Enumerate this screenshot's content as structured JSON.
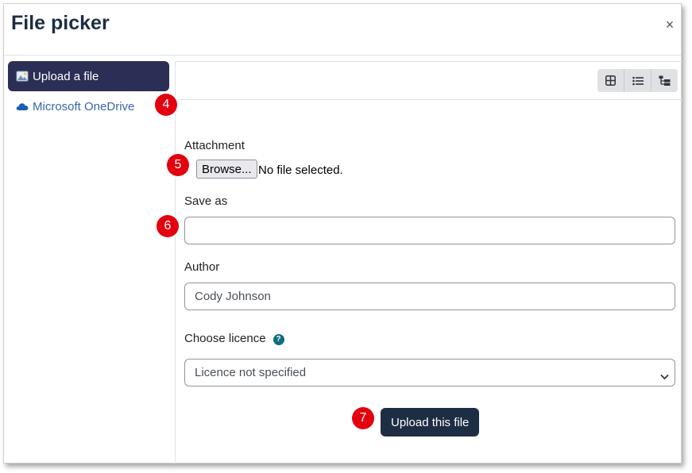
{
  "dialog": {
    "title": "File picker",
    "close_glyph": "×"
  },
  "sidebar": {
    "items": [
      {
        "label": "Upload a file",
        "icon": "upload-icon",
        "active": true
      },
      {
        "label": "Microsoft OneDrive",
        "icon": "onedrive-cloud-icon",
        "active": false
      }
    ]
  },
  "toolbar": {
    "views": [
      "icons-view-icon",
      "list-view-icon",
      "tree-view-icon"
    ]
  },
  "form": {
    "attachment_label": "Attachment",
    "browse_label": "Browse...",
    "no_file_text": "No file selected.",
    "save_as_label": "Save as",
    "save_as_value": "",
    "author_label": "Author",
    "author_value": "Cody Johnson",
    "licence_label": "Choose licence",
    "licence_help_glyph": "?",
    "licence_value": "Licence not specified",
    "upload_label": "Upload this file"
  },
  "annotations": {
    "b4": "4",
    "b5": "5",
    "b6": "6",
    "b7": "7"
  },
  "colors": {
    "primary": "#1d2d44",
    "active_nav": "#2b2e55",
    "link": "#3867a8",
    "annotation": "#e3000f",
    "help": "#0f6e7c"
  }
}
